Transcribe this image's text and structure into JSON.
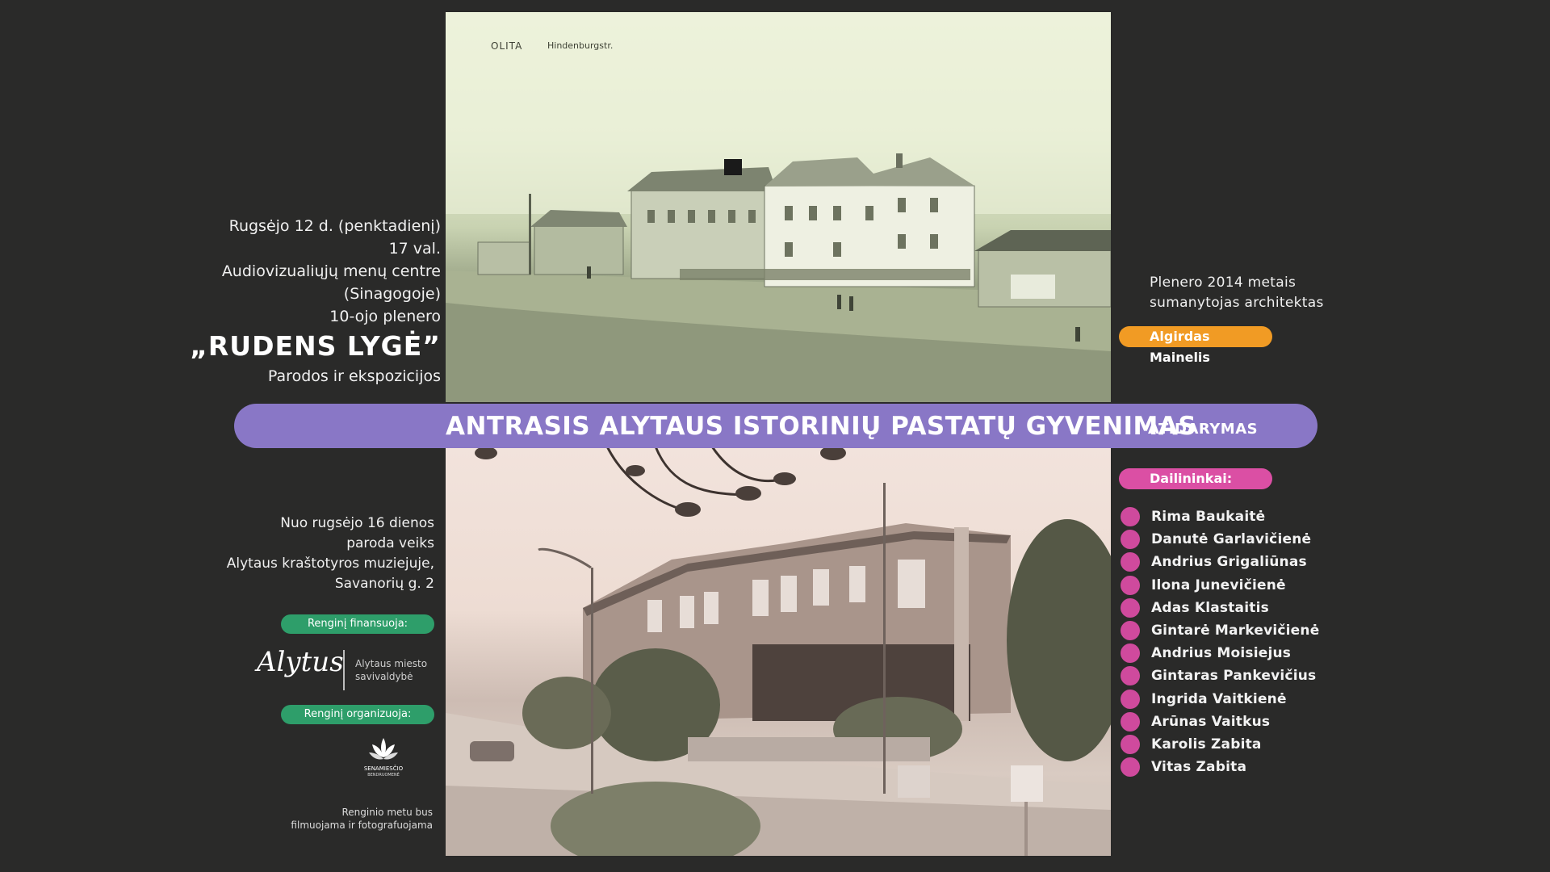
{
  "top_photo": {
    "caption_city": "OLITA",
    "caption_street": "Hindenburgstr."
  },
  "event": {
    "date": "Rugsėjo 12 d. (penktadienį)",
    "time": "17 val.",
    "venue_line1": "Audiovizualiųjų menų centre",
    "venue_line2": "(Sinagogoje)",
    "plenary": "10-ojo plenero",
    "name": "„RUDENS LYGĖ”",
    "subtitle": "Parodos  ir ekspozicijos"
  },
  "banner": {
    "title": "ANTRASIS ALYTAUS ISTORINIŲ PASTATŲ GYVENIMAS",
    "right_label": "ATIDARYMAS"
  },
  "exhibition": {
    "line1": "Nuo rugsėjo 16 dienos",
    "line2": "paroda veiks",
    "line3": "Alytaus kraštotyros muziejuje,",
    "line4": "Savanorių g. 2"
  },
  "funded": {
    "label": "Renginį finansuoja:",
    "logo_text": "Alytus",
    "org_line1": "Alytaus miesto",
    "org_line2": "savivaldybė"
  },
  "organized": {
    "label": "Renginį organizuoja:",
    "logo_text_line1": "SENAMIESČIO",
    "logo_text_line2": "BENDRUOMENĖ"
  },
  "note": {
    "line1": "Renginio metu bus",
    "line2": "filmuojama ir fotografuojama"
  },
  "initiator": {
    "line1": "Plenero 2014 metais",
    "line2": "sumanytojas architektas",
    "name": "Algirdas Mainelis"
  },
  "artists": {
    "label": "Dailininkai:",
    "items": [
      "Rima Baukaitė",
      "Danutė Garlavičienė",
      "Andrius Grigaliūnas",
      "Ilona Junevičienė",
      "Adas Klastaitis",
      "Gintarė Markevičienė",
      "Andrius Moisiejus",
      "Gintaras Pankevičius",
      "Ingrida Vaitkienė",
      "Arūnas Vaitkus",
      "Karolis Zabita",
      "Vitas Zabita"
    ]
  },
  "colors": {
    "background": "#2a2a29",
    "banner": "#8977c6",
    "green": "#2e9e6a",
    "orange": "#f19b24",
    "pink": "#db4fa4"
  }
}
